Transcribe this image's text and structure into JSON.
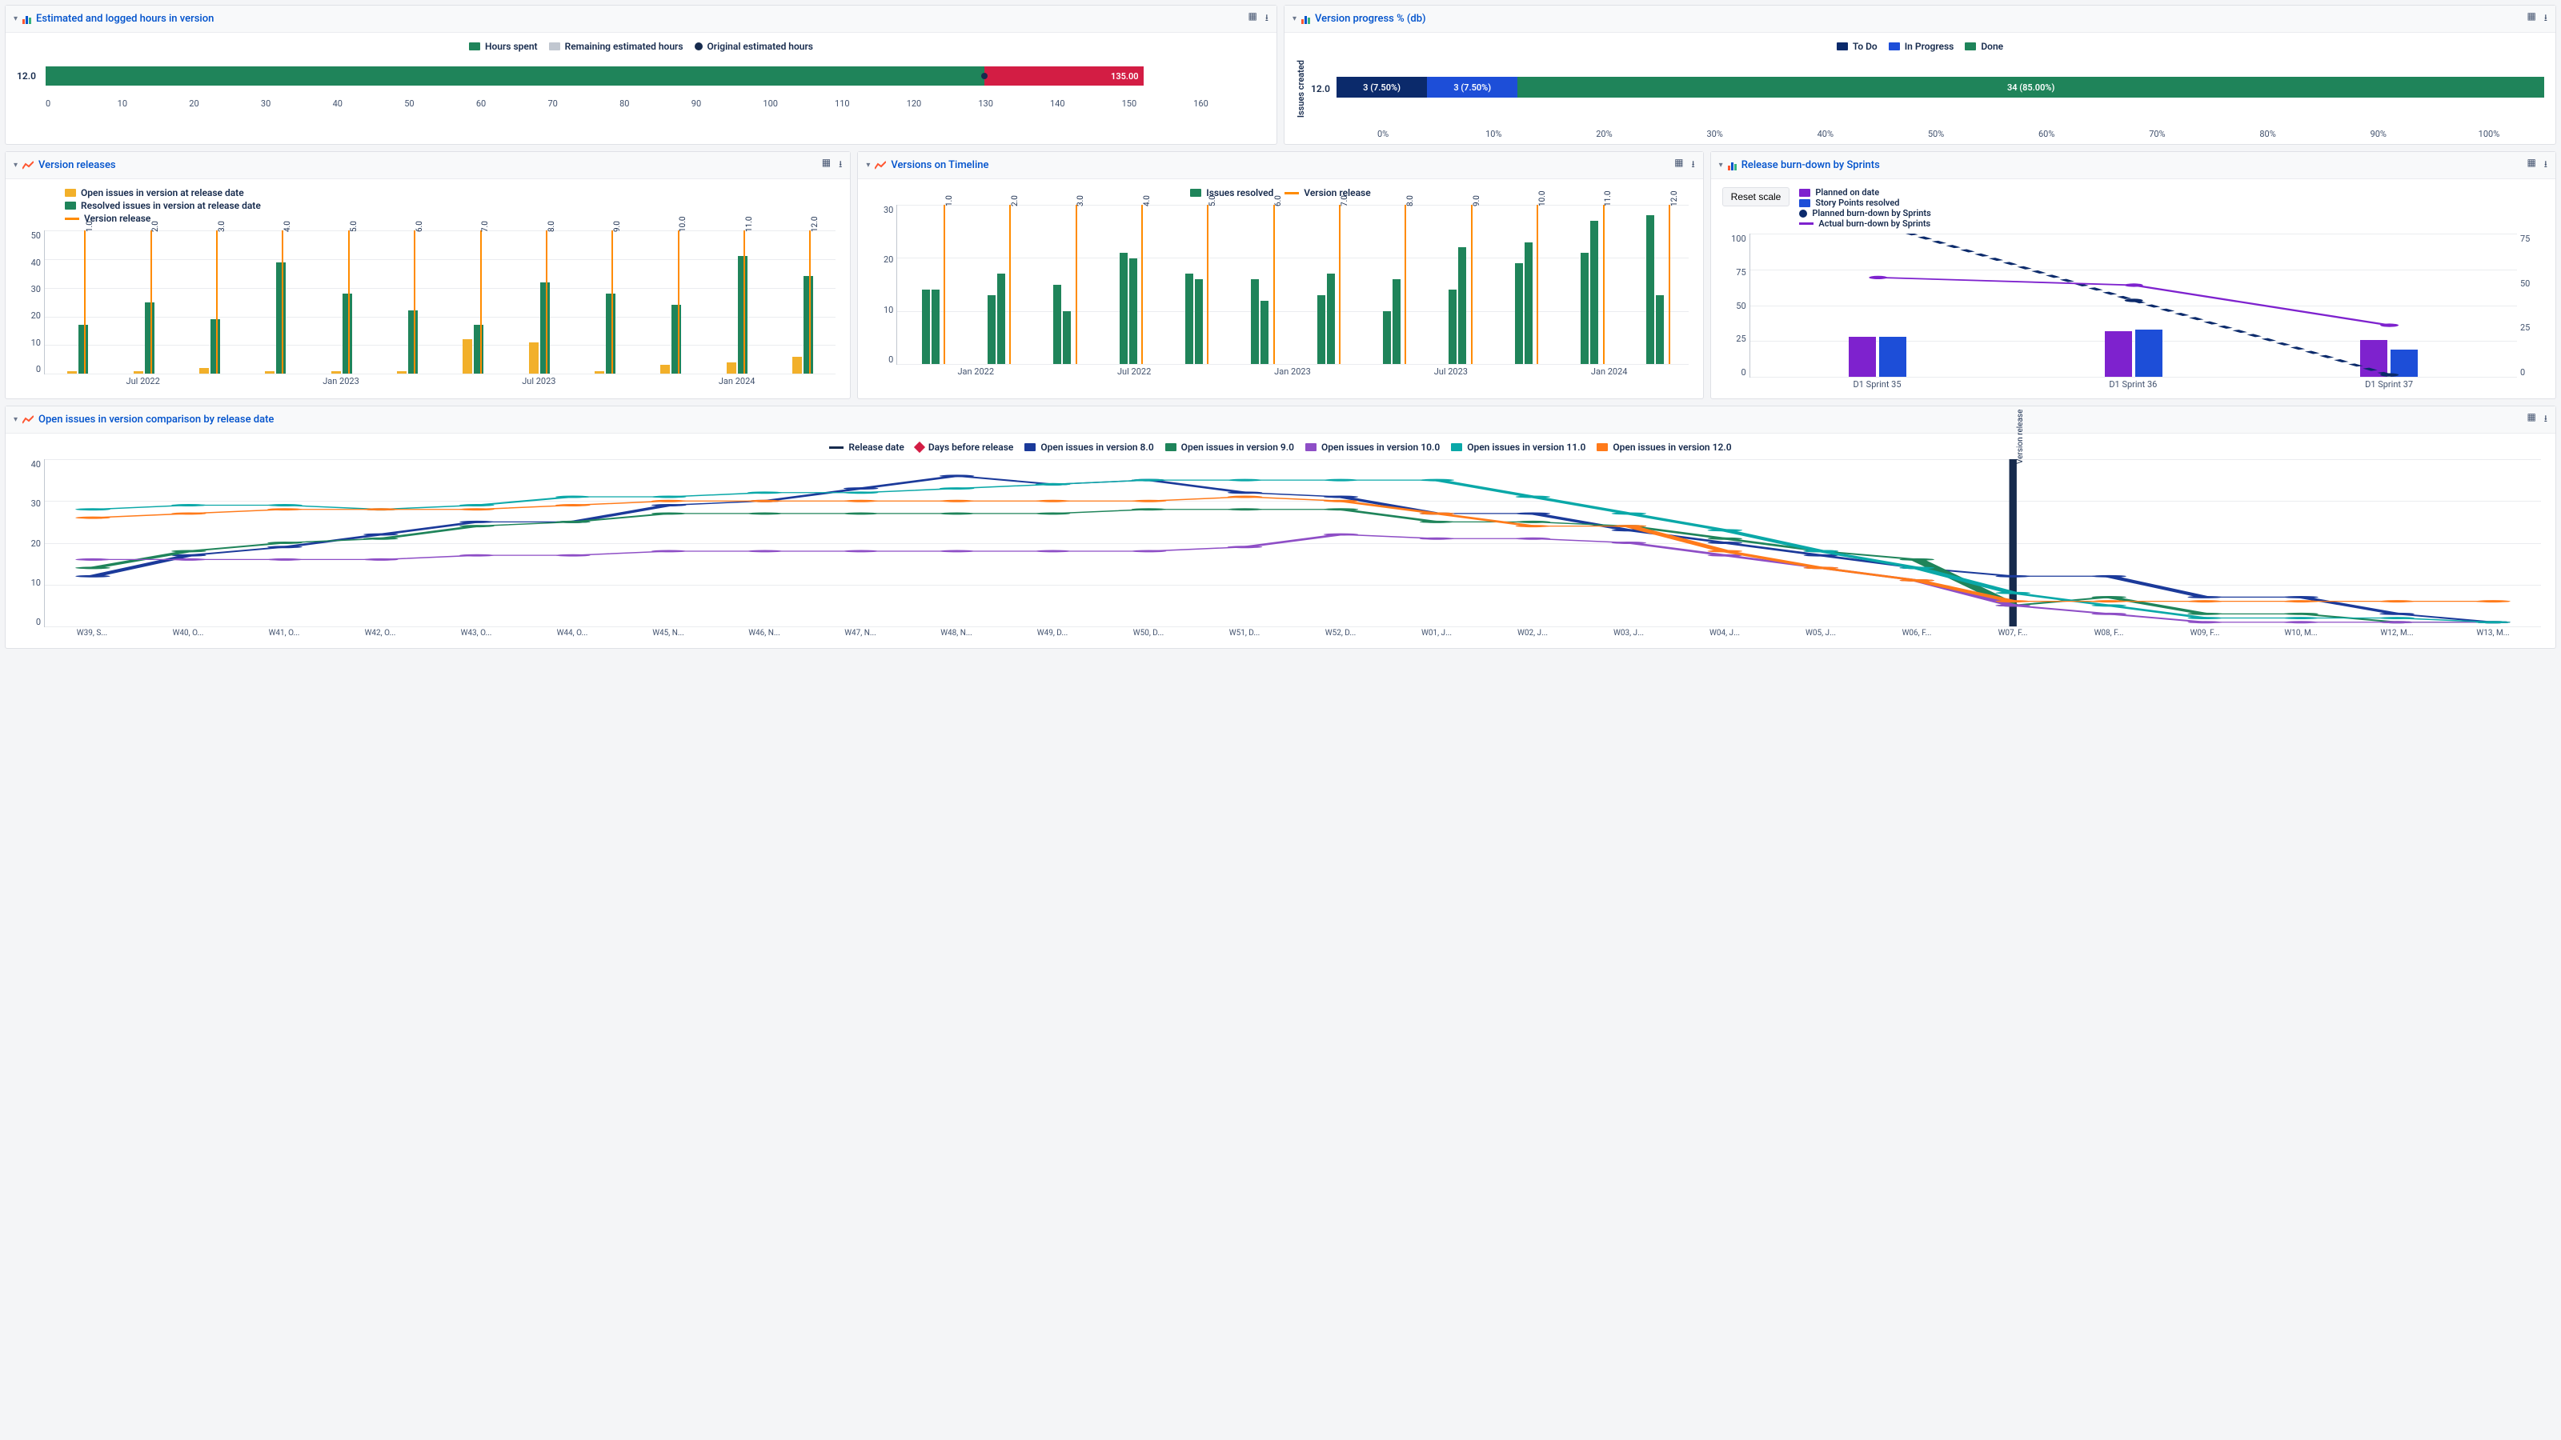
{
  "panels": {
    "hours": {
      "title": "Estimated and logged hours in version",
      "legend": {
        "spent": "Hours spent",
        "remaining": "Remaining estimated hours",
        "original": "Original estimated hours"
      },
      "row_label": "12.0",
      "value_label": "135.00",
      "x_ticks": [
        "0",
        "10",
        "20",
        "30",
        "40",
        "50",
        "60",
        "70",
        "80",
        "90",
        "100",
        "110",
        "120",
        "130",
        "140",
        "150",
        "160"
      ]
    },
    "progress": {
      "title": "Version progress % (db)",
      "legend": {
        "todo": "To Do",
        "inprog": "In Progress",
        "done": "Done"
      },
      "ylabel": "Issues created",
      "row_label": "12.0",
      "seg_todo": "3 (7.50%)",
      "seg_inprog": "3 (7.50%)",
      "seg_done": "34 (85.00%)",
      "x_ticks": [
        "0%",
        "10%",
        "20%",
        "30%",
        "40%",
        "50%",
        "60%",
        "70%",
        "80%",
        "90%",
        "100%"
      ]
    },
    "releases": {
      "title": "Version releases",
      "legend": {
        "open": "Open issues in version at release date",
        "resolved": "Resolved issues in version at release date",
        "release": "Version release"
      },
      "y_ticks": [
        "50",
        "40",
        "30",
        "20",
        "10",
        "0"
      ],
      "x_ticks": [
        "Jul 2022",
        "Jan 2023",
        "Jul 2023",
        "Jan 2024"
      ]
    },
    "timeline": {
      "title": "Versions on Timeline",
      "legend": {
        "resolved": "Issues resolved",
        "release": "Version release"
      },
      "y_ticks": [
        "30",
        "20",
        "10",
        "0"
      ],
      "x_ticks": [
        "Jan 2022",
        "Jul 2022",
        "Jan 2023",
        "Jul 2023",
        "Jan 2024"
      ]
    },
    "burndown": {
      "title": "Release burn-down by Sprints",
      "reset": "Reset scale",
      "legend": {
        "planned_date": "Planned on date",
        "resolved": "Story Points resolved",
        "planned_bd": "Planned burn-down by Sprints",
        "actual_bd": "Actual burn-down by Sprints"
      },
      "y_ticks_l": [
        "100",
        "75",
        "50",
        "25",
        "0"
      ],
      "y_ticks_r": [
        "75",
        "50",
        "25",
        "0"
      ],
      "x_ticks": [
        "D1 Sprint 35",
        "D1 Sprint 36",
        "D1 Sprint 37"
      ]
    },
    "comparison": {
      "title": "Open issues in version comparison by release date",
      "legend": {
        "release": "Release date",
        "days": "Days before release",
        "v8": "Open issues in version 8.0",
        "v9": "Open issues in version 9.0",
        "v10": "Open issues in version 10.0",
        "v11": "Open issues in version 11.0",
        "v12": "Open issues in version 12.0"
      },
      "release_line_label": "Version release",
      "y_ticks": [
        "40",
        "30",
        "20",
        "10",
        "0"
      ],
      "x_ticks": [
        "W39, S...",
        "W40, O...",
        "W41, O...",
        "W42, O...",
        "W43, O...",
        "W44, O...",
        "W45, N...",
        "W46, N...",
        "W47, N...",
        "W48, N...",
        "W49, D...",
        "W50, D...",
        "W51, D...",
        "W52, D...",
        "W01, J...",
        "W02, J...",
        "W03, J...",
        "W04, J...",
        "W05, J...",
        "W06, F...",
        "W07, F...",
        "W08, F...",
        "W09, F...",
        "W10, M...",
        "W12, M...",
        "W13, M..."
      ]
    }
  },
  "chart_data": [
    {
      "id": "hours",
      "type": "bar",
      "orientation": "horizontal",
      "stacked": true,
      "title": "Estimated and logged hours in version",
      "categories": [
        "12.0"
      ],
      "series": [
        {
          "name": "Hours spent",
          "values": [
            123
          ],
          "color": "#1f845a"
        },
        {
          "name": "Remaining estimated hours",
          "values": [
            22
          ],
          "color": "#d31d44"
        }
      ],
      "points": [
        {
          "name": "Original estimated hours",
          "values": [
            135
          ]
        }
      ],
      "xlabel": "",
      "ylabel": "",
      "xlim": [
        0,
        160
      ],
      "data_label": "135.00"
    },
    {
      "id": "progress",
      "type": "bar",
      "orientation": "horizontal",
      "stacked": true,
      "percent": true,
      "title": "Version progress % (db)",
      "ylabel": "Issues created",
      "categories": [
        "12.0"
      ],
      "series": [
        {
          "name": "To Do",
          "values": [
            7.5
          ],
          "count": 3,
          "color": "#0b2a6b"
        },
        {
          "name": "In Progress",
          "values": [
            7.5
          ],
          "count": 3,
          "color": "#1d4ed8"
        },
        {
          "name": "Done",
          "values": [
            85.0
          ],
          "count": 34,
          "color": "#1f845a"
        }
      ],
      "xlim": [
        0,
        100
      ]
    },
    {
      "id": "releases",
      "type": "bar",
      "title": "Version releases",
      "x": [
        "1.0",
        "2.0",
        "3.0",
        "4.0",
        "5.0",
        "6.0",
        "7.0",
        "8.0",
        "9.0",
        "10.0",
        "11.0",
        "12.0"
      ],
      "series": [
        {
          "name": "Open issues in version at release date",
          "values": [
            1,
            1,
            2,
            1,
            1,
            1,
            12,
            11,
            1,
            3,
            4,
            6
          ],
          "color": "#f2b02a"
        },
        {
          "name": "Resolved issues in version at release date",
          "values": [
            17,
            25,
            19,
            39,
            28,
            22,
            17,
            32,
            28,
            24,
            41,
            34
          ],
          "color": "#1f845a"
        }
      ],
      "events": {
        "name": "Version release",
        "labels": [
          "1.0",
          "2.0",
          "3.0",
          "4.0",
          "5.0",
          "6.0",
          "7.0",
          "8.0",
          "9.0",
          "10.0",
          "11.0",
          "12.0"
        ],
        "color": "#ff8b00"
      },
      "ylim": [
        0,
        50
      ],
      "x_axis_ticks": [
        "Jul 2022",
        "Jan 2023",
        "Jul 2023",
        "Jan 2024"
      ]
    },
    {
      "id": "timeline",
      "type": "bar",
      "title": "Versions on Timeline",
      "x": [
        "1.0",
        "2.0",
        "3.0",
        "4.0",
        "5.0",
        "6.0",
        "7.0",
        "8.0",
        "9.0",
        "10.0",
        "11.0",
        "12.0"
      ],
      "series": [
        {
          "name": "Issues resolved",
          "values_pairs": [
            [
              14,
              14
            ],
            [
              13,
              17
            ],
            [
              15,
              10
            ],
            [
              21,
              20
            ],
            [
              17,
              16
            ],
            [
              16,
              12
            ],
            [
              13,
              17
            ],
            [
              10,
              16
            ],
            [
              14,
              22
            ],
            [
              19,
              23
            ],
            [
              21,
              27
            ],
            [
              28,
              13
            ]
          ],
          "color": "#1f845a"
        }
      ],
      "events": {
        "name": "Version release",
        "labels": [
          "1.0",
          "2.0",
          "3.0",
          "4.0",
          "5.0",
          "6.0",
          "7.0",
          "8.0",
          "9.0",
          "10.0",
          "11.0",
          "12.0"
        ],
        "color": "#ff8b00"
      },
      "ylim": [
        0,
        30
      ],
      "x_axis_ticks": [
        "Jan 2022",
        "Jul 2022",
        "Jan 2023",
        "Jul 2023",
        "Jan 2024"
      ]
    },
    {
      "id": "burndown",
      "type": "bar+line",
      "title": "Release burn-down by Sprints",
      "categories": [
        "D1 Sprint 35",
        "D1 Sprint 36",
        "D1 Sprint 37"
      ],
      "bars": [
        {
          "name": "Planned on date",
          "values": [
            28,
            32,
            26
          ],
          "color": "#7e22ce"
        },
        {
          "name": "Story Points resolved",
          "values": [
            28,
            33,
            19
          ],
          "color": "#1d4ed8"
        }
      ],
      "lines": [
        {
          "name": "Planned burn-down by Sprints",
          "axis": "right",
          "values": [
            80,
            40,
            1
          ],
          "color": "#0b2a6b",
          "dashed": true
        },
        {
          "name": "Actual burn-down by Sprints",
          "axis": "right",
          "values": [
            52,
            48,
            27
          ],
          "color": "#7e22ce",
          "dashed": false
        }
      ],
      "ylim_left": [
        0,
        100
      ],
      "ylim_right": [
        0,
        75
      ]
    },
    {
      "id": "comparison",
      "type": "line",
      "title": "Open issues in version comparison by release date",
      "x": [
        "W39",
        "W40",
        "W41",
        "W42",
        "W43",
        "W44",
        "W45",
        "W46",
        "W47",
        "W48",
        "W49",
        "W50",
        "W51",
        "W52",
        "W01",
        "W02",
        "W03",
        "W04",
        "W05",
        "W06",
        "W07",
        "W08",
        "W09",
        "W10",
        "W12",
        "W13"
      ],
      "series": [
        {
          "name": "Open issues in version 8.0",
          "color": "#1b3a9a",
          "values": [
            12,
            17,
            19,
            22,
            25,
            25,
            29,
            30,
            33,
            36,
            34,
            35,
            32,
            31,
            27,
            27,
            23,
            20,
            17,
            14,
            12,
            12,
            7,
            7,
            3,
            1
          ]
        },
        {
          "name": "Open issues in version 9.0",
          "color": "#1f845a",
          "values": [
            14,
            18,
            20,
            21,
            24,
            25,
            27,
            27,
            27,
            27,
            27,
            28,
            28,
            28,
            25,
            25,
            24,
            21,
            18,
            16,
            5,
            7,
            3,
            3,
            1,
            1
          ]
        },
        {
          "name": "Open issues in version 10.0",
          "color": "#8e4ec6",
          "values": [
            16,
            16,
            16,
            16,
            17,
            17,
            18,
            18,
            18,
            18,
            18,
            18,
            19,
            22,
            21,
            21,
            20,
            17,
            14,
            11,
            5,
            3,
            1,
            1,
            1,
            1
          ]
        },
        {
          "name": "Open issues in version 11.0",
          "color": "#0aa8a8",
          "values": [
            28,
            29,
            29,
            28,
            29,
            31,
            31,
            32,
            32,
            33,
            34,
            35,
            35,
            35,
            35,
            31,
            27,
            23,
            18,
            14,
            8,
            5,
            2,
            2,
            2,
            1
          ]
        },
        {
          "name": "Open issues in version 12.0",
          "color": "#ff7a1a",
          "values": [
            26,
            27,
            28,
            28,
            28,
            29,
            30,
            30,
            30,
            30,
            30,
            30,
            31,
            30,
            27,
            24,
            24,
            18,
            14,
            11,
            6,
            6,
            6,
            6,
            6,
            6
          ]
        }
      ],
      "release_marker": {
        "name": "Version release",
        "x": "W07"
      },
      "ylim": [
        0,
        40
      ]
    }
  ]
}
